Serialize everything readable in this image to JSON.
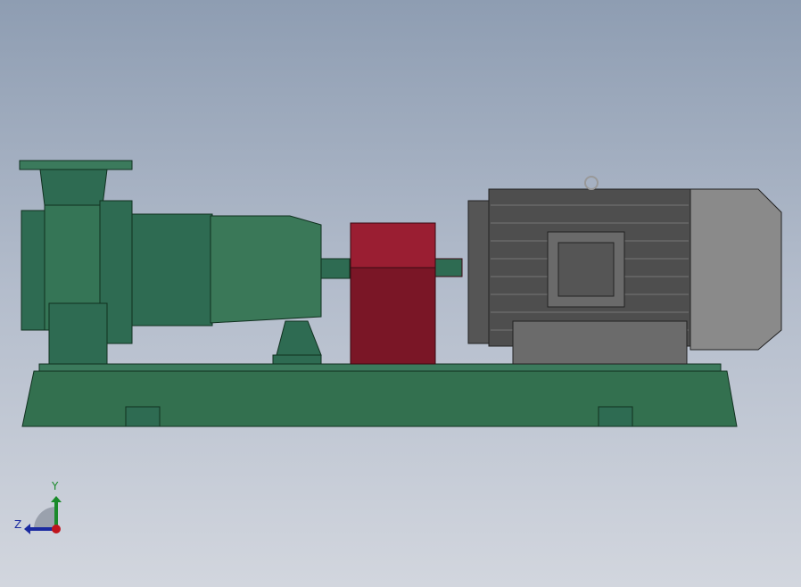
{
  "triad": {
    "y_label": "Y",
    "z_label": "Z"
  },
  "colors": {
    "pump_green": "#2e6b52",
    "coupling_guard": "#7a1626",
    "motor_grey": "#5a5a5a",
    "x_axis": "#c0141c",
    "y_axis": "#1a8a2a",
    "z_axis": "#1a2aa0"
  }
}
